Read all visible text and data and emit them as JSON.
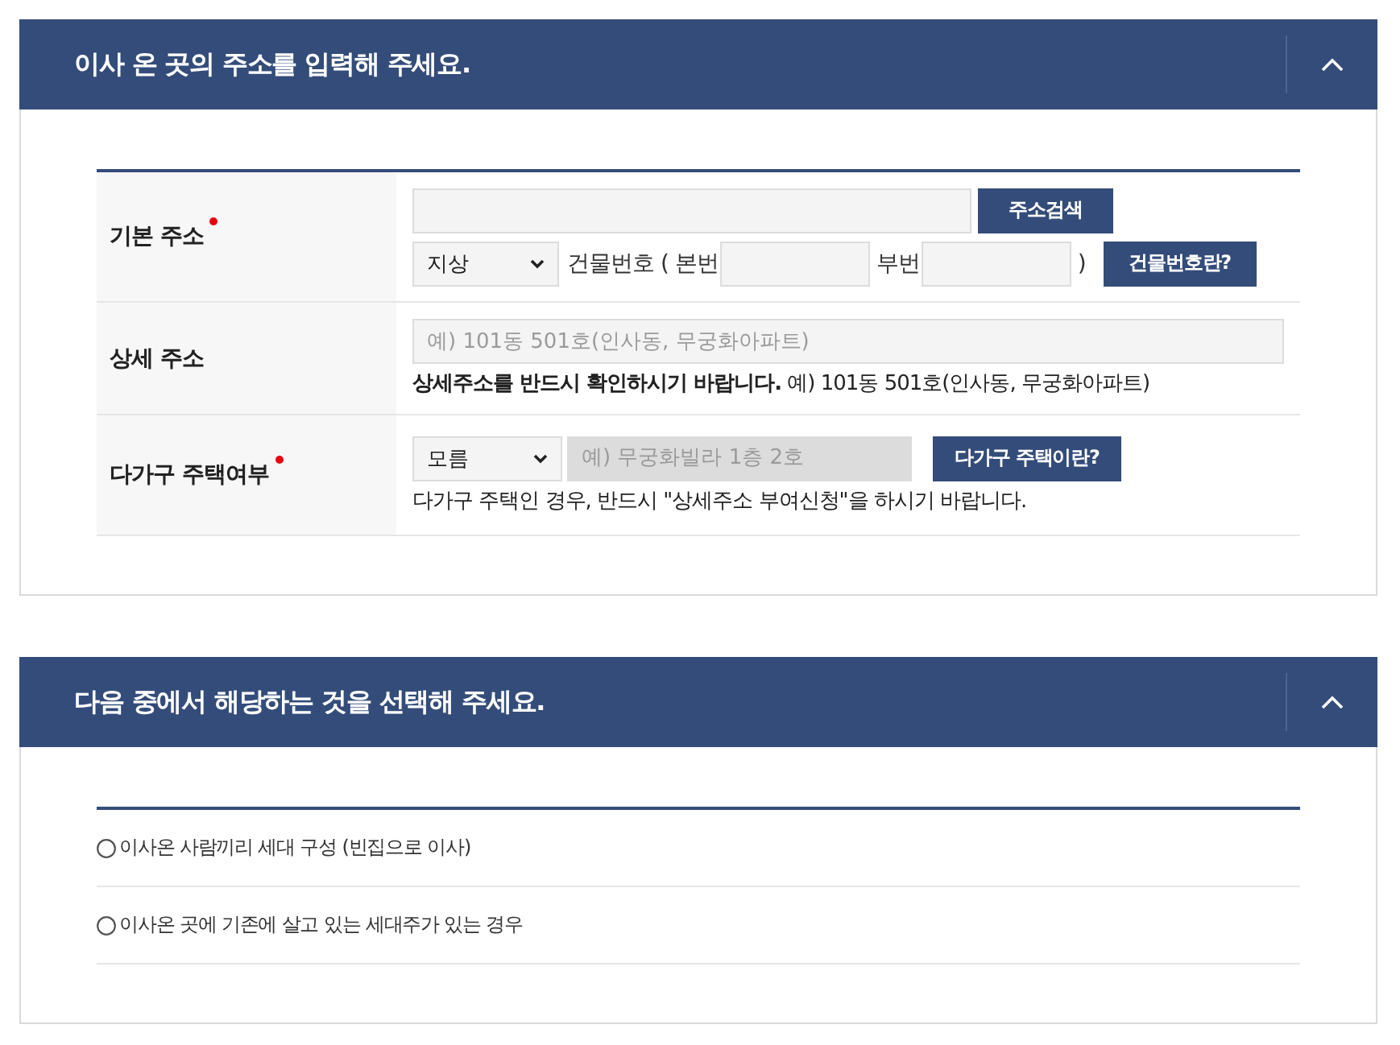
{
  "sections": [
    {
      "kind": "address_form",
      "title": "이사 온 곳의 주소를 입력해 주세요.",
      "expanded": true,
      "rows": [
        {
          "label": "기본 주소",
          "required": true,
          "lines": [
            [
              {
                "kind": "input",
                "disabled": false
              },
              {
                "kind": "button",
                "label": "주소검색"
              }
            ],
            [
              {
                "kind": "select",
                "value": "지상"
              },
              {
                "kind": "text",
                "text": "건물번호 ( 본번"
              },
              {
                "kind": "input",
                "disabled": false
              },
              {
                "kind": "text",
                "text": "부번"
              },
              {
                "kind": "input",
                "disabled": false
              },
              {
                "kind": "text",
                "text": ")"
              },
              {
                "kind": "button",
                "label": "건물번호란?"
              }
            ]
          ]
        },
        {
          "label": "상세 주소",
          "required": false,
          "lines": [
            [
              {
                "kind": "input",
                "placeholder": "예) 101동 501호(인사동, 무궁화아파트)",
                "disabled": false
              }
            ]
          ],
          "note": "**상세주소를 반드시 확인하시기 바랍니다.** 예) 101동 501호(인사동, 무궁화아파트)"
        },
        {
          "label": "다가구 주택여부",
          "required": true,
          "lines": [
            [
              {
                "kind": "select",
                "value": "모름"
              },
              {
                "kind": "input",
                "placeholder": "예) 무궁화빌라 1층 2호",
                "disabled": true
              },
              {
                "kind": "button",
                "label": "다가구 주택이란?"
              }
            ]
          ],
          "note": "다가구 주택인 경우, 반드시 \"상세주소 부여신청\"을 하시기 바랍니다."
        }
      ]
    },
    {
      "kind": "choice_list",
      "title": "다음 중에서 해당하는 것을 선택해 주세요.",
      "expanded": true,
      "options": [
        {
          "label": "이사온 사람끼리 세대 구성 (빈집으로 이사)",
          "selected": false
        },
        {
          "label": "이사온 곳에 기존에 살고 있는 세대주가 있는 경우",
          "selected": false
        }
      ]
    }
  ]
}
